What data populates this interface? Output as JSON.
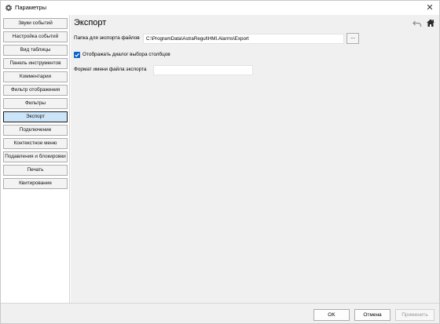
{
  "window": {
    "title": "Параметры",
    "close_glyph": "✕",
    "icon": "gear-icon"
  },
  "sidebar": {
    "items": [
      {
        "label": "Звуки событий",
        "active": false
      },
      {
        "label": "Настройка событий",
        "active": false
      },
      {
        "label": "Вид таблицы",
        "active": false
      },
      {
        "label": "Панель инструментов",
        "active": false
      },
      {
        "label": "Комментарии",
        "active": false
      },
      {
        "label": "Фильтр отображения",
        "active": false
      },
      {
        "label": "Фильтры",
        "active": false
      },
      {
        "label": "Экспорт",
        "active": true
      },
      {
        "label": "Подключение",
        "active": false
      },
      {
        "label": "Контекстное меню",
        "active": false
      },
      {
        "label": "Подавления и блокировки",
        "active": false
      },
      {
        "label": "Печать",
        "active": false
      },
      {
        "label": "Квитирование",
        "active": false
      }
    ]
  },
  "main": {
    "title": "Экспорт",
    "export_folder": {
      "label": "Папка для экспорта файлов",
      "value": "C:\\ProgramData\\AstraRegul\\HMI.Alarms\\Export",
      "browse_label": "..."
    },
    "show_columns_dialog": {
      "label": "Отображать диалог выбора столбцов",
      "checked": true
    },
    "file_name_format": {
      "label": "Формат имени файла экспорта",
      "value": ""
    }
  },
  "footer": {
    "ok_label": "OK",
    "cancel_label": "Отмена",
    "apply_label": "Применить"
  },
  "colors": {
    "accent": "#0a64c8",
    "active_item_bg": "#cce4f7",
    "panel_bg": "#f0f0f0"
  }
}
